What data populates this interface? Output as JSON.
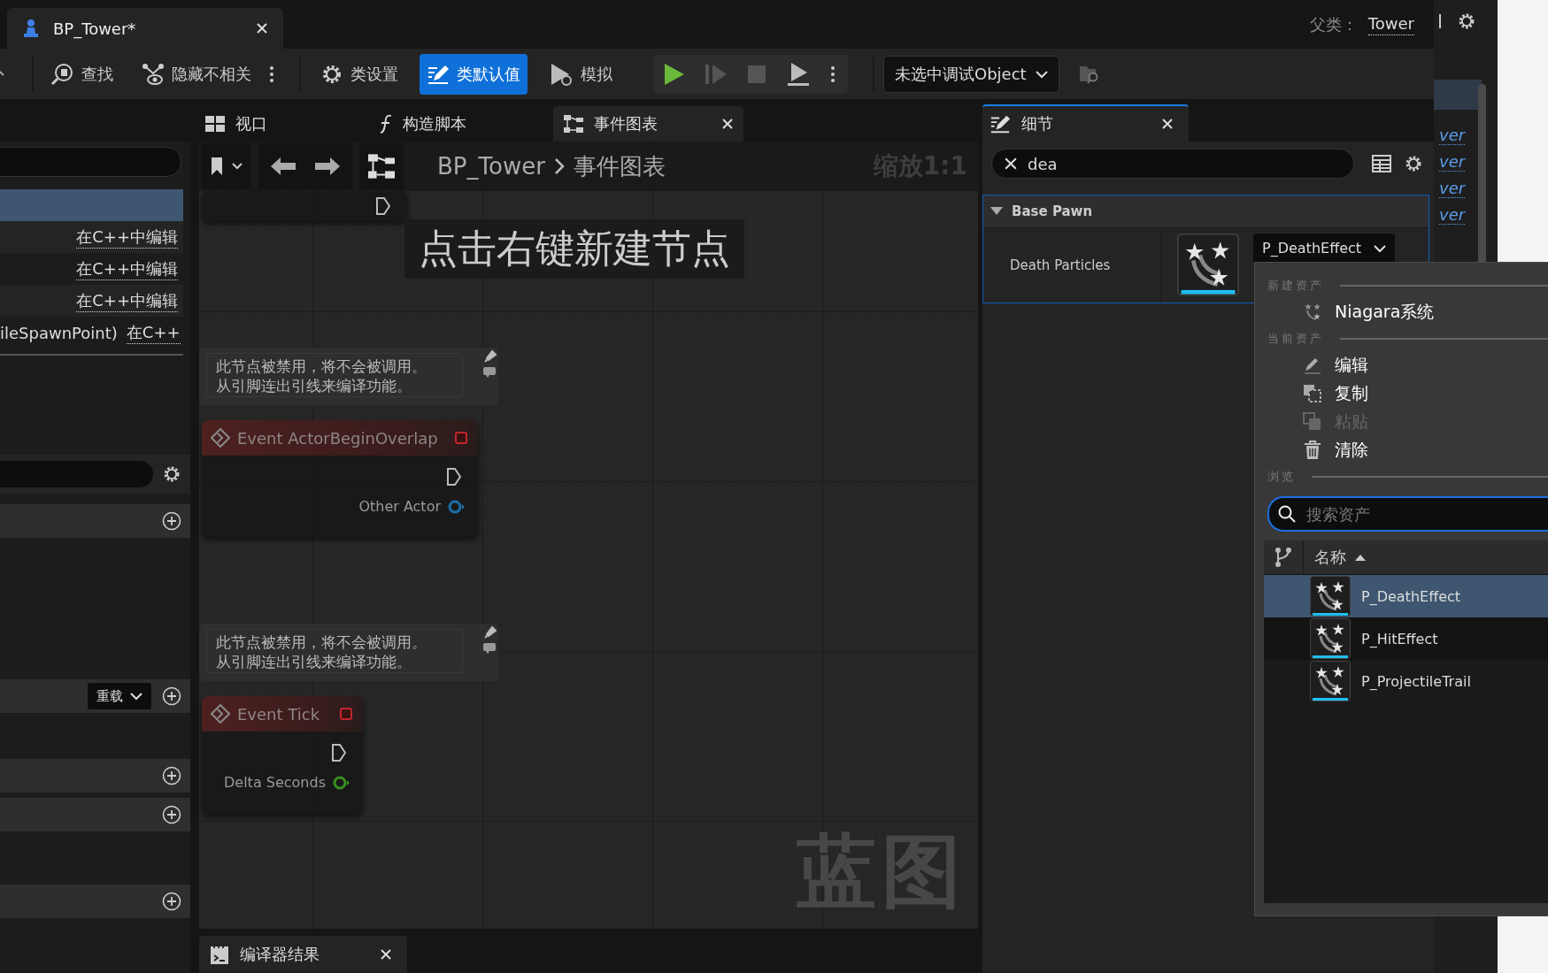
{
  "document_tab": {
    "title": "BP_Tower*"
  },
  "parent_class": {
    "label": "父类：",
    "value": "Tower"
  },
  "toolbar": [
    {
      "kind": "find",
      "label": "查找",
      "selected": false
    },
    {
      "kind": "hide",
      "label": "隐藏不相关",
      "selected": false
    },
    {
      "kind": "settings",
      "label": "类设置",
      "selected": false
    },
    {
      "kind": "defaults",
      "label": "类默认值",
      "selected": true
    },
    {
      "kind": "simulate",
      "label": "模拟",
      "selected": false
    }
  ],
  "debug_object": "未选中调试Object",
  "left_panel": {
    "rows": [
      {
        "selected": true
      },
      {
        "link": "在C++中编辑",
        "selected": false
      },
      {
        "link": "在C++中编辑",
        "selected": false
      },
      {
        "link": "在C++中编辑",
        "selected": false
      },
      {
        "name": "ileSpawnPoint)",
        "link": "在C++",
        "selected": false
      }
    ],
    "sections": [
      {
        "kind": "search"
      },
      {
        "kind": "header"
      },
      {
        "kind": "header",
        "dropdown": "重载"
      },
      {
        "kind": "header"
      },
      {
        "kind": "header"
      },
      {
        "kind": "header"
      }
    ]
  },
  "editor_tabs": [
    {
      "kind": "viewport",
      "label": "视口",
      "selected": false
    },
    {
      "kind": "construction",
      "label": "构造脚本",
      "selected": false
    },
    {
      "kind": "graph",
      "label": "事件图表",
      "selected": true
    }
  ],
  "graph": {
    "breadcrumb": [
      "BP_Tower",
      "事件图表"
    ],
    "zoom": "缩放1:1",
    "hint": "点击右键新建节点",
    "watermark": "蓝图",
    "nodes": [
      {
        "kind": "clipped"
      },
      {
        "kind": "event",
        "title": "Event ActorBeginOverlap",
        "comment": [
          "此节点被禁用，将不会被调用。",
          "从引脚连出引线来编译功能。"
        ],
        "pins": [
          {
            "label": "Other Actor",
            "color": "#1b6fa8"
          }
        ]
      },
      {
        "kind": "event",
        "title": "Event Tick",
        "comment": [
          "此节点被禁用，将不会被调用。",
          "从引脚连出引线来编译功能。"
        ],
        "pins": [
          {
            "label": "Delta Seconds",
            "color": "#3a8f1f"
          }
        ]
      }
    ]
  },
  "bottom_tab": {
    "label": "编译器结果"
  },
  "details": {
    "tab": "细节",
    "search": "dea",
    "category": {
      "title": "Base Pawn",
      "expanded": true
    },
    "property": {
      "label": "Death Particles",
      "value": "P_DeathEffect"
    }
  },
  "asset_picker": {
    "sections": [
      {
        "heading": "新建资产",
        "items": [
          {
            "kind": "niagara",
            "label": "Niagara系统",
            "disabled": false
          }
        ]
      },
      {
        "heading": "当前资产",
        "items": [
          {
            "kind": "edit",
            "label": "编辑",
            "disabled": false
          },
          {
            "kind": "copy",
            "label": "复制",
            "disabled": false
          },
          {
            "kind": "paste",
            "label": "粘贴",
            "disabled": true
          },
          {
            "kind": "clear",
            "label": "清除",
            "disabled": false
          }
        ]
      },
      {
        "heading": "浏览"
      }
    ],
    "search_placeholder": "搜索资产",
    "column": "名称",
    "assets": [
      {
        "name": "P_DeathEffect",
        "selected": true
      },
      {
        "name": "P_HitEffect",
        "selected": false
      },
      {
        "name": "P_ProjectileTrail",
        "selected": false
      }
    ]
  },
  "side_links": [
    "ver",
    "ver",
    "ver",
    "ver"
  ]
}
